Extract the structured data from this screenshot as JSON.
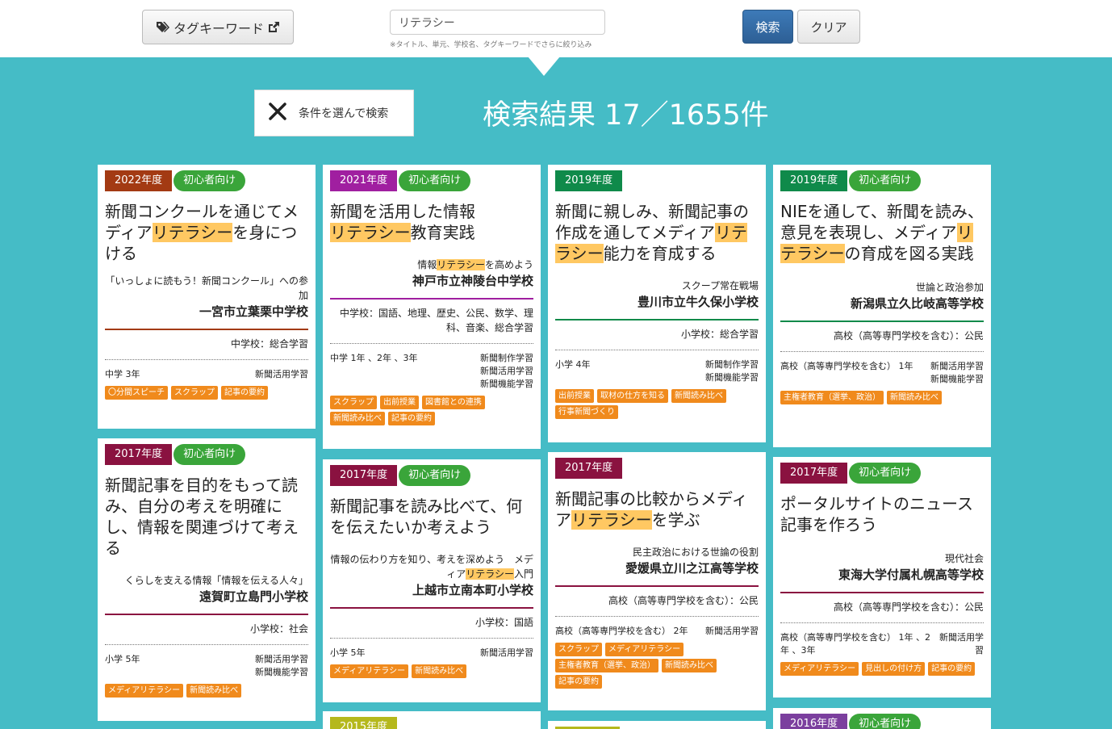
{
  "header": {
    "tag_keyword_label": "タグキーワード",
    "search_value": "リテラシー",
    "search_hint": "※タイトル、単元、学校名、タグキーワードでさらに絞り込み",
    "search_button": "検索",
    "clear_button": "クリア"
  },
  "conditions_button": "条件を選んで検索",
  "results_title": "検索結果 17／1655件",
  "colors": {
    "background": "#45bcc6",
    "highlight": "#ffc862",
    "tag": "#f08a1c",
    "level": "#3aa53a"
  },
  "cards": [
    {
      "year": "2022年度",
      "year_color": "#a33a13",
      "level": "初心者向け",
      "accent": "#a33a13",
      "title_pre": "新聞コンクールを通じてメディア",
      "title_hl": "リテラシー",
      "title_post": "を身につける",
      "unit_pre": "「いっしょに読もう！新聞コンクール」への参加",
      "unit_hl": "",
      "unit_post": "",
      "school": "一宮市立葉栗中学校",
      "subject": "中学校：総合学習",
      "grade": "中学 3年",
      "categories": [
        "新聞活用学習"
      ],
      "tags": [
        "〇分間スピーチ",
        "スクラップ",
        "記事の要約"
      ]
    },
    {
      "year": "2021年度",
      "year_color": "#a01fa0",
      "level": "初心者向け",
      "accent": "#a01fa0",
      "title_pre": "新聞を活用した情報",
      "title_hl": "リテラシー",
      "title_post": "教育実践",
      "unit_pre": "情報",
      "unit_hl": "リテラシー",
      "unit_post": "を高めよう",
      "school": "神戸市立神陵台中学校",
      "subject": "中学校：国語、地理、歴史、公民、数学、理科、音楽、総合学習",
      "grade": "中学 1年 、2年 、3年",
      "categories": [
        "新聞制作学習",
        "新聞活用学習",
        "新聞機能学習"
      ],
      "tags": [
        "スクラップ",
        "出前授業",
        "図書館との連携",
        "新聞読み比べ",
        "記事の要約"
      ]
    },
    {
      "year": "2019年度",
      "year_color": "#0f8a4a",
      "level": "",
      "accent": "#0f8a4a",
      "title_pre": "新聞に親しみ、新聞記事の作成を通してメディア",
      "title_hl": "リテラシー",
      "title_post": "能力を育成する",
      "unit_pre": "スクープ常在戦場",
      "unit_hl": "",
      "unit_post": "",
      "school": "豊川市立牛久保小学校",
      "subject": "小学校：総合学習",
      "grade": "小学 4年",
      "categories": [
        "新聞制作学習",
        "新聞機能学習"
      ],
      "tags": [
        "出前授業",
        "取材の仕方を知る",
        "新聞読み比べ",
        "行事新聞づくり"
      ]
    },
    {
      "year": "2019年度",
      "year_color": "#0f8a4a",
      "level": "初心者向け",
      "accent": "#0f8a4a",
      "title_pre": "NIEを通して、新聞を読み、意見を表現し、メディア",
      "title_hl": "リテラシー",
      "title_post": "の育成を図る実践",
      "unit_pre": "世論と政治参加",
      "unit_hl": "",
      "unit_post": "",
      "school": "新潟県立久比岐高等学校",
      "subject": "高校（高等専門学校を含む）：公民",
      "grade": "高校（高等専門学校を含む） 1年",
      "categories": [
        "新聞活用学習",
        "新聞機能学習"
      ],
      "tags": [
        "主権者教育（選挙、政治）",
        "新聞読み比べ"
      ]
    },
    {
      "year": "2017年度",
      "year_color": "#8a1240",
      "level": "初心者向け",
      "accent": "#8a1240",
      "title_pre": "新聞記事を目的をもって読み、自分の考えを明確にし、情報を関連づけて考える",
      "title_hl": "",
      "title_post": "",
      "unit_pre": "くらしを支える情報「情報を伝える人々」",
      "unit_hl": "",
      "unit_post": "",
      "school": "遠賀町立島門小学校",
      "subject": "小学校：社会",
      "grade": "小学 5年",
      "categories": [
        "新聞活用学習",
        "新聞機能学習"
      ],
      "tags": [
        "メディアリテラシー",
        "新聞読み比べ"
      ]
    },
    {
      "year": "2017年度",
      "year_color": "#8a1240",
      "level": "初心者向け",
      "accent": "#8a1240",
      "title_pre": "新聞記事を読み比べて、何を伝えたいか考えよう",
      "title_hl": "",
      "title_post": "",
      "unit_pre": "情報の伝わり方を知り、考えを深めよう　メディア",
      "unit_hl": "リテラシー",
      "unit_post": "入門",
      "school": "上越市立南本町小学校",
      "subject": "小学校：国語",
      "grade": "小学 5年",
      "categories": [
        "新聞活用学習"
      ],
      "tags": [
        "メディアリテラシー",
        "新聞読み比べ"
      ]
    },
    {
      "year": "2017年度",
      "year_color": "#8a1240",
      "level": "",
      "accent": "#8a1240",
      "title_pre": "新聞記事の比較からメディア",
      "title_hl": "リテラシー",
      "title_post": "を学ぶ",
      "unit_pre": "民主政治における世論の役割",
      "unit_hl": "",
      "unit_post": "",
      "school": "愛媛県立川之江高等学校",
      "subject": "高校（高等専門学校を含む）：公民",
      "grade": "高校（高等専門学校を含む） 2年",
      "categories": [
        "新聞活用学習"
      ],
      "tags": [
        "スクラップ",
        "メディアリテラシー",
        "主権者教育（選挙、政治）",
        "新聞読み比べ",
        "記事の要約"
      ]
    },
    {
      "year": "2017年度",
      "year_color": "#8a1240",
      "level": "初心者向け",
      "accent": "#8a1240",
      "title_pre": "ポータルサイトのニュース記事を作ろう",
      "title_hl": "",
      "title_post": "",
      "unit_pre": "現代社会",
      "unit_hl": "",
      "unit_post": "",
      "school": "東海大学付属札幌高等学校",
      "subject": "高校（高等専門学校を含む）：公民",
      "grade": "高校（高等専門学校を含む） 1年 、2年 、3年",
      "categories": [
        "新聞活用学習"
      ],
      "tags": [
        "メディアリテラシー",
        "見出しの付け方",
        "記事の要約"
      ]
    },
    {
      "year": "2015年度",
      "year_color": "#b5b81c",
      "level": ""
    },
    {
      "year": "",
      "year_color": "#b5b81c",
      "level": ""
    },
    {
      "year": "2016年度",
      "year_color": "#7b3f9e",
      "level": "初心者向け"
    }
  ]
}
